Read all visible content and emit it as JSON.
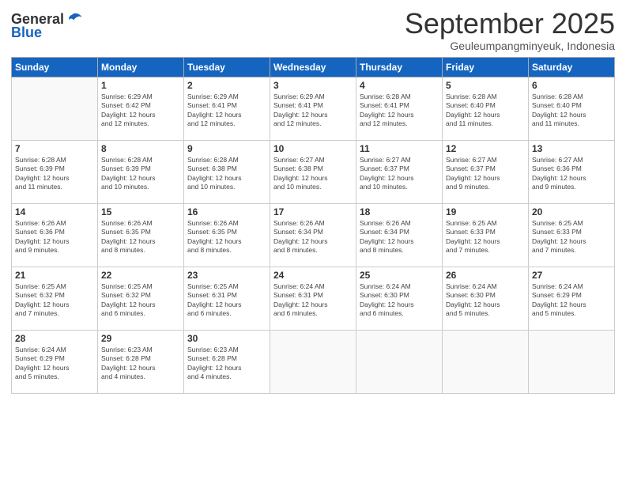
{
  "header": {
    "logo_general": "General",
    "logo_blue": "Blue",
    "month_title": "September 2025",
    "subtitle": "Geuleumpangminyeuk, Indonesia"
  },
  "calendar": {
    "days_of_week": [
      "Sunday",
      "Monday",
      "Tuesday",
      "Wednesday",
      "Thursday",
      "Friday",
      "Saturday"
    ],
    "weeks": [
      [
        {
          "day": "",
          "info": ""
        },
        {
          "day": "1",
          "info": "Sunrise: 6:29 AM\nSunset: 6:42 PM\nDaylight: 12 hours\nand 12 minutes."
        },
        {
          "day": "2",
          "info": "Sunrise: 6:29 AM\nSunset: 6:41 PM\nDaylight: 12 hours\nand 12 minutes."
        },
        {
          "day": "3",
          "info": "Sunrise: 6:29 AM\nSunset: 6:41 PM\nDaylight: 12 hours\nand 12 minutes."
        },
        {
          "day": "4",
          "info": "Sunrise: 6:28 AM\nSunset: 6:41 PM\nDaylight: 12 hours\nand 12 minutes."
        },
        {
          "day": "5",
          "info": "Sunrise: 6:28 AM\nSunset: 6:40 PM\nDaylight: 12 hours\nand 11 minutes."
        },
        {
          "day": "6",
          "info": "Sunrise: 6:28 AM\nSunset: 6:40 PM\nDaylight: 12 hours\nand 11 minutes."
        }
      ],
      [
        {
          "day": "7",
          "info": "Sunrise: 6:28 AM\nSunset: 6:39 PM\nDaylight: 12 hours\nand 11 minutes."
        },
        {
          "day": "8",
          "info": "Sunrise: 6:28 AM\nSunset: 6:39 PM\nDaylight: 12 hours\nand 10 minutes."
        },
        {
          "day": "9",
          "info": "Sunrise: 6:28 AM\nSunset: 6:38 PM\nDaylight: 12 hours\nand 10 minutes."
        },
        {
          "day": "10",
          "info": "Sunrise: 6:27 AM\nSunset: 6:38 PM\nDaylight: 12 hours\nand 10 minutes."
        },
        {
          "day": "11",
          "info": "Sunrise: 6:27 AM\nSunset: 6:37 PM\nDaylight: 12 hours\nand 10 minutes."
        },
        {
          "day": "12",
          "info": "Sunrise: 6:27 AM\nSunset: 6:37 PM\nDaylight: 12 hours\nand 9 minutes."
        },
        {
          "day": "13",
          "info": "Sunrise: 6:27 AM\nSunset: 6:36 PM\nDaylight: 12 hours\nand 9 minutes."
        }
      ],
      [
        {
          "day": "14",
          "info": "Sunrise: 6:26 AM\nSunset: 6:36 PM\nDaylight: 12 hours\nand 9 minutes."
        },
        {
          "day": "15",
          "info": "Sunrise: 6:26 AM\nSunset: 6:35 PM\nDaylight: 12 hours\nand 8 minutes."
        },
        {
          "day": "16",
          "info": "Sunrise: 6:26 AM\nSunset: 6:35 PM\nDaylight: 12 hours\nand 8 minutes."
        },
        {
          "day": "17",
          "info": "Sunrise: 6:26 AM\nSunset: 6:34 PM\nDaylight: 12 hours\nand 8 minutes."
        },
        {
          "day": "18",
          "info": "Sunrise: 6:26 AM\nSunset: 6:34 PM\nDaylight: 12 hours\nand 8 minutes."
        },
        {
          "day": "19",
          "info": "Sunrise: 6:25 AM\nSunset: 6:33 PM\nDaylight: 12 hours\nand 7 minutes."
        },
        {
          "day": "20",
          "info": "Sunrise: 6:25 AM\nSunset: 6:33 PM\nDaylight: 12 hours\nand 7 minutes."
        }
      ],
      [
        {
          "day": "21",
          "info": "Sunrise: 6:25 AM\nSunset: 6:32 PM\nDaylight: 12 hours\nand 7 minutes."
        },
        {
          "day": "22",
          "info": "Sunrise: 6:25 AM\nSunset: 6:32 PM\nDaylight: 12 hours\nand 6 minutes."
        },
        {
          "day": "23",
          "info": "Sunrise: 6:25 AM\nSunset: 6:31 PM\nDaylight: 12 hours\nand 6 minutes."
        },
        {
          "day": "24",
          "info": "Sunrise: 6:24 AM\nSunset: 6:31 PM\nDaylight: 12 hours\nand 6 minutes."
        },
        {
          "day": "25",
          "info": "Sunrise: 6:24 AM\nSunset: 6:30 PM\nDaylight: 12 hours\nand 6 minutes."
        },
        {
          "day": "26",
          "info": "Sunrise: 6:24 AM\nSunset: 6:30 PM\nDaylight: 12 hours\nand 5 minutes."
        },
        {
          "day": "27",
          "info": "Sunrise: 6:24 AM\nSunset: 6:29 PM\nDaylight: 12 hours\nand 5 minutes."
        }
      ],
      [
        {
          "day": "28",
          "info": "Sunrise: 6:24 AM\nSunset: 6:29 PM\nDaylight: 12 hours\nand 5 minutes."
        },
        {
          "day": "29",
          "info": "Sunrise: 6:23 AM\nSunset: 6:28 PM\nDaylight: 12 hours\nand 4 minutes."
        },
        {
          "day": "30",
          "info": "Sunrise: 6:23 AM\nSunset: 6:28 PM\nDaylight: 12 hours\nand 4 minutes."
        },
        {
          "day": "",
          "info": ""
        },
        {
          "day": "",
          "info": ""
        },
        {
          "day": "",
          "info": ""
        },
        {
          "day": "",
          "info": ""
        }
      ]
    ]
  }
}
